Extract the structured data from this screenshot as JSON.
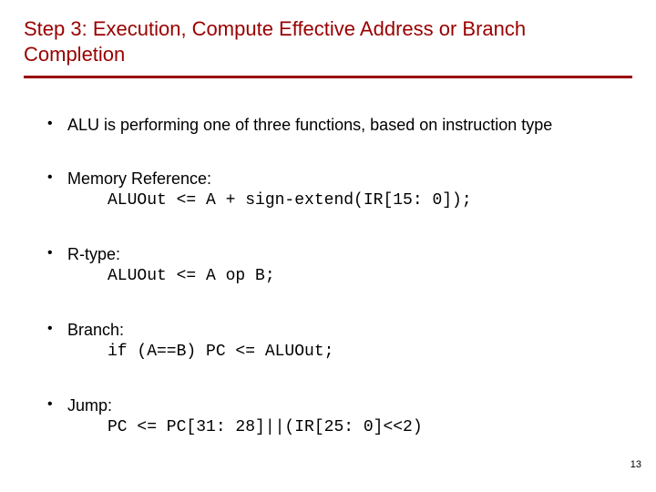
{
  "title": "Step 3: Execution, Compute Effective Address or Branch Completion",
  "bullets": {
    "intro": "ALU is performing one of three functions, based on instruction type",
    "memref_label": "Memory Reference:",
    "memref_code": "ALUOut <= A + sign-extend(IR[15: 0]);",
    "rtype_label": "R-type:",
    "rtype_code": "ALUOut <= A op B;",
    "branch_label": "Branch:",
    "branch_code": "if (A==B) PC <= ALUOut;",
    "jump_label": "Jump:",
    "jump_code": "PC <= PC[31: 28]||(IR[25: 0]<<2)"
  },
  "page_number": "13"
}
